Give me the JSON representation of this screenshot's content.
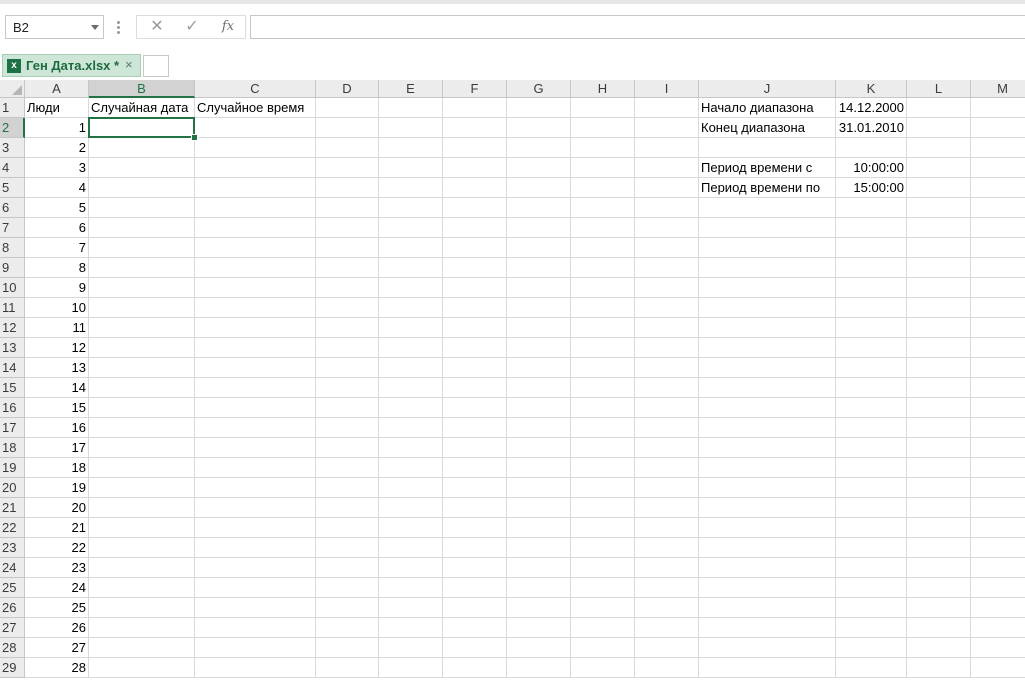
{
  "formula_bar": {
    "name_box": "B2",
    "cancel_icon": "✕",
    "enter_icon": "✓",
    "fx_label": "fx",
    "formula": ""
  },
  "tabs": {
    "doc_tab_label": "Ген Дата.xlsx *",
    "doc_tab_icon": "x",
    "doc_tab_close": "×"
  },
  "sheet": {
    "columns": [
      "A",
      "B",
      "C",
      "D",
      "E",
      "F",
      "G",
      "H",
      "I",
      "J",
      "K",
      "L",
      "M"
    ],
    "rows": [
      "1",
      "2",
      "3",
      "4",
      "5",
      "6",
      "7",
      "8",
      "9",
      "10",
      "11",
      "12",
      "13",
      "14",
      "15",
      "16",
      "17",
      "18",
      "19",
      "20",
      "21",
      "22",
      "23",
      "24",
      "25",
      "26",
      "27",
      "28",
      "29"
    ],
    "selected_cell": "B2",
    "headers": {
      "A1": "Люди",
      "B1": "Случайная дата",
      "C1": "Случайное время"
    },
    "people_numbers": [
      "1",
      "2",
      "3",
      "4",
      "5",
      "6",
      "7",
      "8",
      "9",
      "10",
      "11",
      "12",
      "13",
      "14",
      "15",
      "16",
      "17",
      "18",
      "19",
      "20",
      "21",
      "22",
      "23",
      "24",
      "25",
      "26",
      "27",
      "28"
    ],
    "params": {
      "J1": "Начало диапазона",
      "K1": "14.12.2000",
      "J2": "Конец диапазона",
      "K2": "31.01.2010",
      "J4": "Период времени с",
      "K4": "10:00:00",
      "J5": "Период времени по",
      "K5": "15:00:00"
    }
  }
}
